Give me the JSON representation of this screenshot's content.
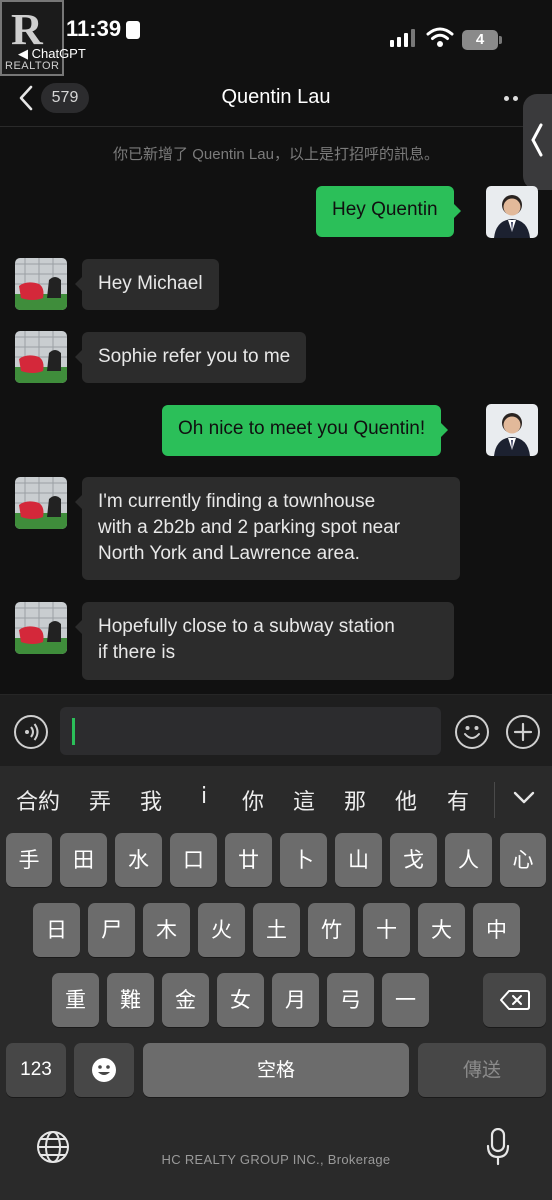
{
  "status_bar": {
    "time": "11:39",
    "back_app_label": "◀ ChatGPT",
    "battery_level": "4",
    "watermark_logo_text": "REALTOR"
  },
  "nav": {
    "unread_count": "579",
    "title": "Quentin Lau"
  },
  "system_note": "你已新增了 Quentin Lau，以上是打招呼的訊息。",
  "messages": [
    {
      "sender": "me",
      "text": "Hey Quentin"
    },
    {
      "sender": "contact",
      "text": "Hey Michael"
    },
    {
      "sender": "contact",
      "text": "Sophie refer you to me"
    },
    {
      "sender": "me",
      "text": "Oh nice to meet you Quentin!"
    },
    {
      "sender": "contact",
      "lines": [
        "I'm currently finding a townhouse",
        "with a 2b2b and 2 parking spot near",
        "North York and Lawrence area."
      ]
    },
    {
      "sender": "contact",
      "lines": [
        "Hopefully close to a subway station",
        "if there is"
      ]
    }
  ],
  "composer": {
    "icons": [
      "voice-icon",
      "emoji-icon",
      "plus-icon"
    ]
  },
  "keyboard": {
    "candidates": [
      "合約",
      "弄",
      "我",
      "i",
      "你",
      "這",
      "那",
      "他",
      "有"
    ],
    "row1": [
      "手",
      "田",
      "水",
      "口",
      "廿",
      "卜",
      "山",
      "戈",
      "人",
      "心"
    ],
    "row2": [
      "日",
      "尸",
      "木",
      "火",
      "土",
      "竹",
      "十",
      "大",
      "中"
    ],
    "row3": [
      "重",
      "難",
      "金",
      "女",
      "月",
      "弓",
      "一"
    ],
    "numbers_key": "123",
    "space_key": "空格",
    "send_key": "傳送",
    "accent_color": "#2bbf59"
  },
  "footer": {
    "brokerage": "HC REALTY GROUP INC., Brokerage"
  }
}
